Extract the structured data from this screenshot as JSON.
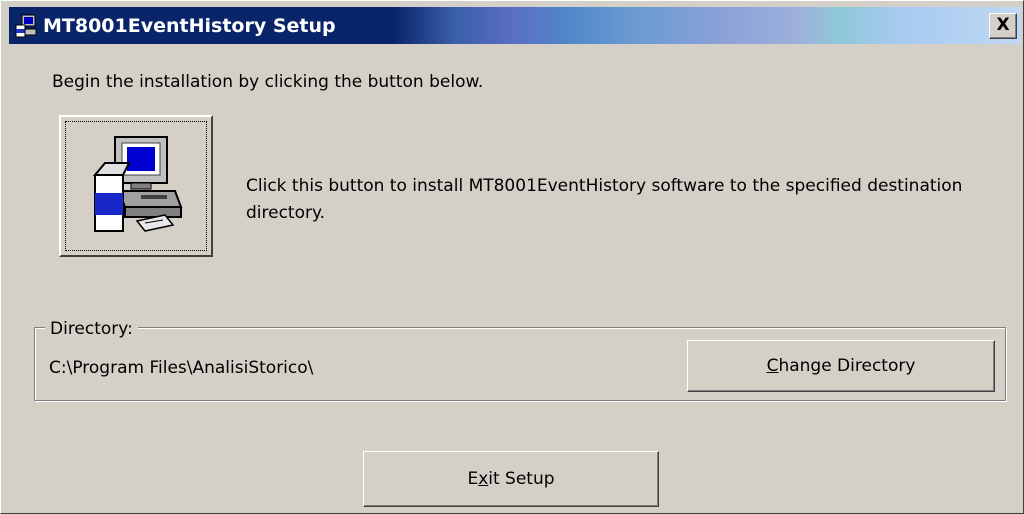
{
  "window": {
    "title": "MT8001EventHistory Setup",
    "close_label": "X"
  },
  "intro_text": "Begin the installation by clicking the button below.",
  "install": {
    "icon": "setup-computer-icon",
    "description": "Click this button to install MT8001EventHistory software to the specified destination directory."
  },
  "directory": {
    "group_label": "Directory:",
    "path": "C:\\Program Files\\AnalisiStorico\\",
    "change_label_pre": "",
    "change_label_key": "C",
    "change_label_post": "hange Directory"
  },
  "exit": {
    "label_pre": "E",
    "label_key": "x",
    "label_post": "it Setup"
  }
}
